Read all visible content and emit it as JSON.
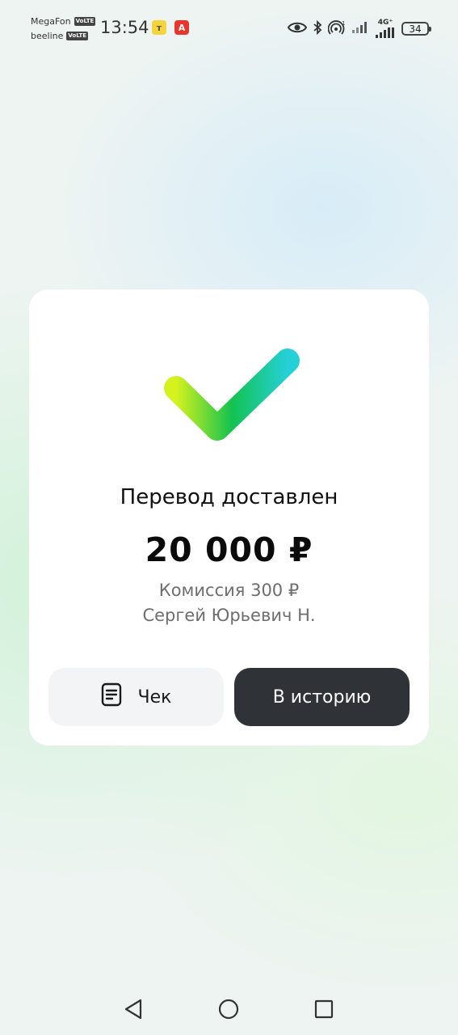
{
  "status_bar": {
    "carrier_1": "MegaFon",
    "carrier_2": "beeline",
    "volte": "VoLTE",
    "time": "13:54",
    "app_badge_1": "т",
    "app_badge_2": "А",
    "network_label": "4G⁺",
    "battery": "34",
    "icons": [
      "eye-icon",
      "bluetooth-icon",
      "hotspot-icon",
      "signal-icon",
      "signal-icon",
      "battery-icon"
    ]
  },
  "card": {
    "title": "Перевод доставлен",
    "amount": "20 000 ₽",
    "commission": "Комиссия 300 ₽",
    "recipient": "Сергей Юрьевич Н.",
    "receipt_button": "Чек",
    "history_button": "В историю"
  },
  "colors": {
    "check_start": "#d6f21e",
    "check_mid": "#13c24f",
    "check_end": "#25d0d8",
    "primary_button": "#2f3236",
    "secondary_button": "#f3f4f5"
  },
  "navbar": {
    "icons": [
      "back-icon",
      "home-icon",
      "recents-icon"
    ]
  }
}
